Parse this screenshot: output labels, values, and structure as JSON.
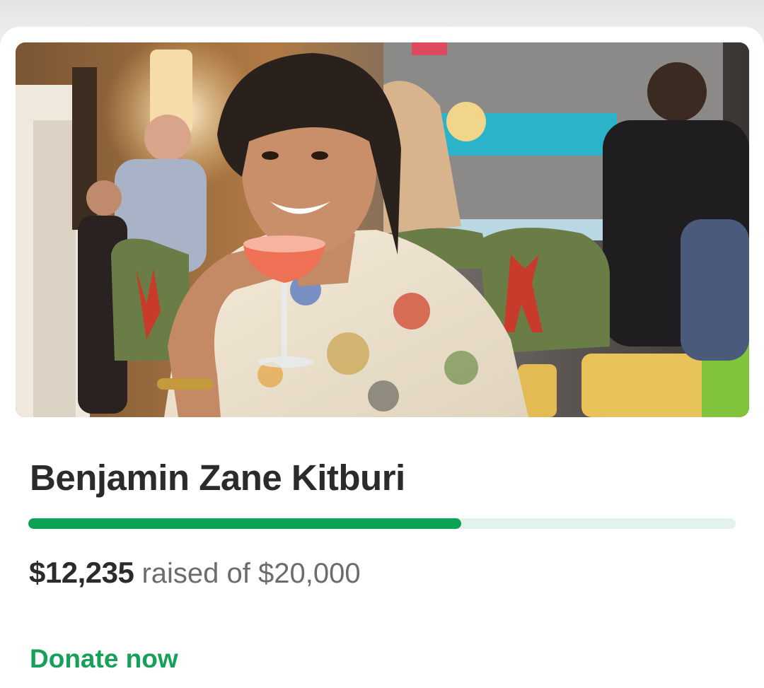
{
  "campaign": {
    "name": "Benjamin Zane Kitburi",
    "raised": "$12,235",
    "raised_suffix": "raised of",
    "goal": "$20,000",
    "progress_fraction": 0.612
  },
  "actions": {
    "donate_label": "Donate now"
  },
  "colors": {
    "accent_green": "#0aa356",
    "track": "#e3f3ec",
    "text": "#2b2b2b",
    "muted": "#6c6c6c"
  },
  "image": {
    "subject": "man-holding-cocktail-photo"
  }
}
